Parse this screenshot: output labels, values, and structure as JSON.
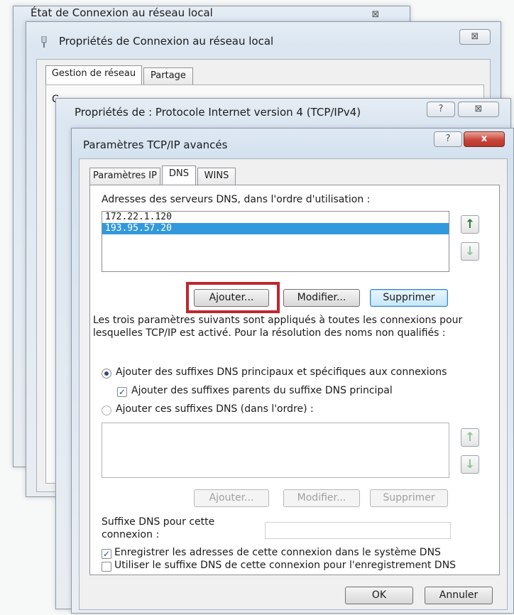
{
  "window1": {
    "title": "État de Connexion au réseau local",
    "close": "⊠"
  },
  "window2": {
    "title": "Propriétés de Connexion au réseau local",
    "close": "⊠",
    "tabs": [
      {
        "label": "Gestion de réseau"
      },
      {
        "label": "Partage"
      }
    ],
    "partial_text": "C"
  },
  "window3": {
    "title": "Propriétés de : Protocole Internet version 4 (TCP/IPv4)",
    "help": "?",
    "close": "⊠"
  },
  "dialog": {
    "title": "Paramètres TCP/IP avancés",
    "help": "?",
    "close": "x",
    "tabs": [
      {
        "label": "Paramètres IP"
      },
      {
        "label": "DNS"
      },
      {
        "label": "WINS"
      }
    ],
    "dns_servers_label": "Adresses des serveurs DNS, dans l'ordre d'utilisation :",
    "dns_servers": [
      "172.22.1.120",
      "193.95.57.20"
    ],
    "selected_server": "193.95.57.20",
    "add_button": "Ajouter...",
    "modify_button": "Modifier...",
    "delete_button": "Supprimer",
    "info_line1": "Les trois paramètres suivants sont appliqués à toutes les connexions pour",
    "info_line2": "lesquelles TCP/IP est activé. Pour la résolution des noms non qualifiés :",
    "radio_primary": "Ajouter des suffixes DNS principaux et spécifiques aux connexions",
    "check_parent": "Ajouter des suffixes parents du suffixe DNS principal",
    "radio_ordered": "Ajouter ces suffixes DNS (dans l'ordre) :",
    "add_button2": "Ajouter...",
    "modify_button2": "Modifier...",
    "delete_button2": "Supprimer",
    "suffix_label1": "Suffixe DNS pour cette",
    "suffix_label2": "connexion :",
    "suffix_value": "",
    "check_register": "Enregistrer les adresses de cette connexion dans le système DNS",
    "check_use_suffix": "Utiliser le suffixe DNS de cette connexion pour l'enregistrement DNS",
    "ok_button": "OK",
    "cancel_button": "Annuler",
    "arrow_up": "↑",
    "arrow_down": "↓",
    "checkmark": "✓"
  },
  "colors": {
    "highlight": "#c0262d",
    "selection": "#3399dd",
    "close_red": "#c8453a"
  }
}
